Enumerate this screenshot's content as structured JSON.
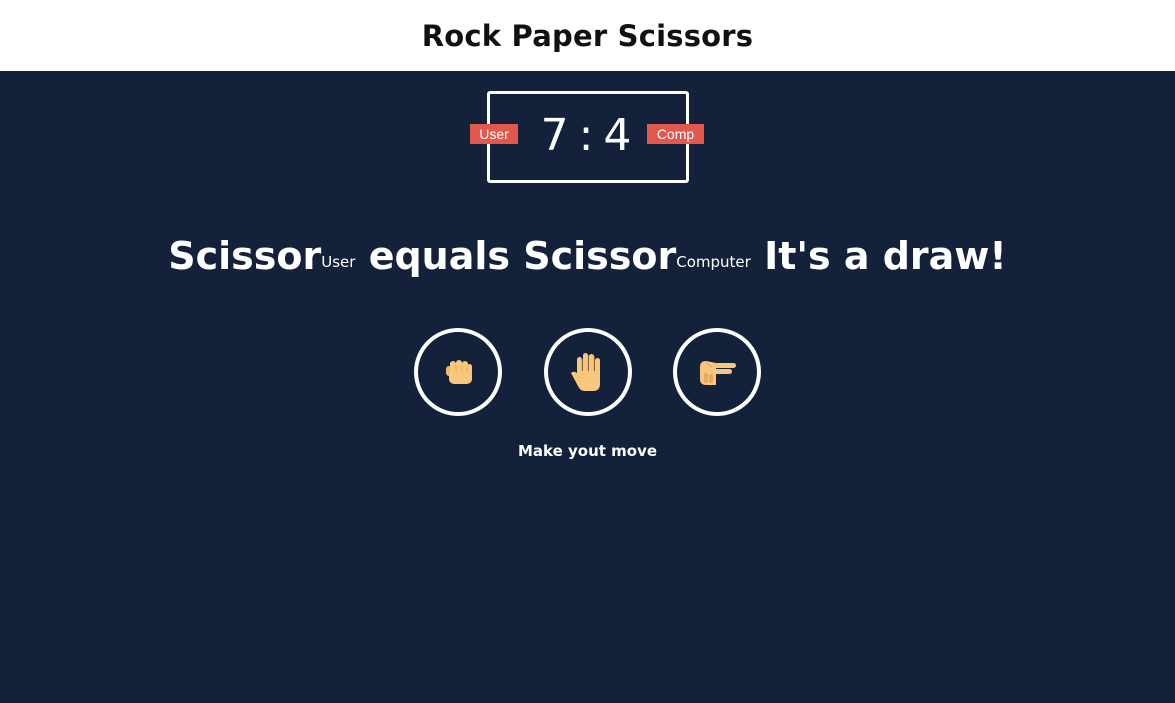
{
  "header": {
    "title": "Rock Paper Scissors"
  },
  "score": {
    "user_label": "User",
    "comp_label": "Comp",
    "user_score": "7",
    "separator": ":",
    "comp_score": "4"
  },
  "result": {
    "user_choice": "Scissor",
    "user_tag": "User",
    "verb": "equals",
    "comp_choice": "Scissor",
    "comp_tag": "Computer",
    "outcome": "It's a draw!"
  },
  "choices": [
    {
      "name": "rock",
      "icon": "fist-hand-icon"
    },
    {
      "name": "paper",
      "icon": "open-hand-icon"
    },
    {
      "name": "scissors",
      "icon": "scissors-hand-icon"
    }
  ],
  "prompt": "Make yout move",
  "colors": {
    "background": "#14213b",
    "header_bg": "#ffffff",
    "badge": "#e2584d",
    "hand": "#f9c77c"
  }
}
